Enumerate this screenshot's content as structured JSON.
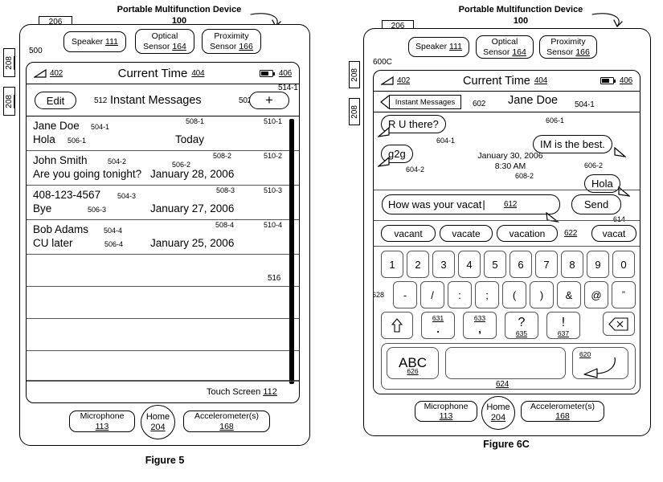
{
  "figure5": {
    "header": {
      "title": "Portable Multifunction Device",
      "number": "100"
    },
    "refs": {
      "top_tab": "206",
      "side_tab_1": "208",
      "side_tab_2": "208",
      "screen_ref": "500"
    },
    "sensors": [
      {
        "label": "Speaker",
        "num": "111"
      },
      {
        "label": "Optical",
        "label2": "Sensor",
        "num": "164"
      },
      {
        "label": "Proximity",
        "label2": "Sensor",
        "num": "166"
      }
    ],
    "statusbar": {
      "signal_ref": "402",
      "time": "Current Time",
      "time_ref": "404",
      "battery_ref": "406"
    },
    "navbar": {
      "edit_label": "Edit",
      "edit_ref": "512",
      "title": "Instant Messages",
      "title_ref": "502",
      "add_label": "+",
      "add_ref": "514-1"
    },
    "messages": [
      {
        "name": "Jane Doe",
        "name_ref": "504-1",
        "preview": "Hola",
        "preview_ref": "506-1",
        "date": "Today",
        "date_ref": "508-1",
        "chevron_ref": "510-1"
      },
      {
        "name": "John Smith",
        "name_ref": "504-2",
        "preview": "Are you going tonight?",
        "preview_ref": "506-2",
        "date": "January 28, 2006",
        "date_ref": "508-2",
        "chevron_ref": "510-2"
      },
      {
        "name": "408-123-4567",
        "name_ref": "504-3",
        "preview": "Bye",
        "preview_ref": "506-3",
        "date": "January 27, 2006",
        "date_ref": "508-3",
        "chevron_ref": "510-3"
      },
      {
        "name": "Bob Adams",
        "name_ref": "504-4",
        "preview": "CU later",
        "preview_ref": "506-4",
        "date": "January 25, 2006",
        "date_ref": "508-4",
        "chevron_ref": "510-4"
      }
    ],
    "list_ref": "516",
    "touchscreen": {
      "label": "Touch Screen",
      "num": "112"
    },
    "bottom": [
      {
        "label": "Microphone",
        "num": "113"
      },
      {
        "label": "Home",
        "num": "204"
      },
      {
        "label": "Accelerometer(s)",
        "num": "168"
      }
    ],
    "caption": "Figure 5"
  },
  "figure6c": {
    "header": {
      "title": "Portable Multifunction Device",
      "number": "100"
    },
    "refs": {
      "top_tab": "206",
      "side_tab_1": "208",
      "side_tab_2": "208",
      "screen_ref": "600C"
    },
    "sensors": [
      {
        "label": "Speaker",
        "num": "111"
      },
      {
        "label": "Optical",
        "label2": "Sensor",
        "num": "164"
      },
      {
        "label": "Proximity",
        "label2": "Sensor",
        "num": "166"
      }
    ],
    "statusbar": {
      "signal_ref": "402",
      "time": "Current Time",
      "time_ref": "404",
      "battery_ref": "406"
    },
    "navbar": {
      "back_label": "Instant Messages",
      "back_ref": "602",
      "title": "Jane Doe",
      "title_ref": "504-1"
    },
    "bubbles": [
      {
        "text": "R U there?",
        "ref": "604-1",
        "side": "left"
      },
      {
        "text": "IM is the best.",
        "ref": "606-1",
        "side": "right"
      },
      {
        "text": "g2g",
        "ref": "604-2",
        "side": "left"
      },
      {
        "text": "Hola",
        "ref": "606-2",
        "side": "right"
      }
    ],
    "convo_date": {
      "date": "January 30, 2006",
      "time": "8:30 AM",
      "ref": "608-2"
    },
    "input": {
      "value": "How was your vacat",
      "ref": "612",
      "send_label": "Send",
      "send_ref": "614"
    },
    "suggestions": {
      "items": [
        "vacant",
        "vacate",
        "vacation"
      ],
      "ref": "622",
      "current": "vacat"
    },
    "keyboard": {
      "ref": "628",
      "row1": [
        "1",
        "2",
        "3",
        "4",
        "5",
        "6",
        "7",
        "8",
        "9",
        "0"
      ],
      "row2": [
        "-",
        "/",
        ":",
        ";",
        "(",
        ")",
        "&",
        "@",
        "\""
      ],
      "row3": [
        {
          "glyph": "⇧",
          "name": "shift",
          "num": ""
        },
        {
          "glyph": ".",
          "name": "period",
          "num": "631"
        },
        {
          "glyph": ",",
          "name": "comma",
          "num": "633"
        },
        {
          "glyph": "?",
          "name": "question",
          "num": "635"
        },
        {
          "glyph": "!",
          "name": "exclamation",
          "num": "637"
        },
        {
          "glyph": "⌫",
          "name": "backspace",
          "num": ""
        }
      ],
      "abc_label": "ABC",
      "abc_ref": "626",
      "space_ref": "624",
      "return_ref": "620"
    },
    "bottom": [
      {
        "label": "Microphone",
        "num": "113"
      },
      {
        "label": "Home",
        "num": "204"
      },
      {
        "label": "Accelerometer(s)",
        "num": "168"
      }
    ],
    "caption": "Figure 6C"
  }
}
